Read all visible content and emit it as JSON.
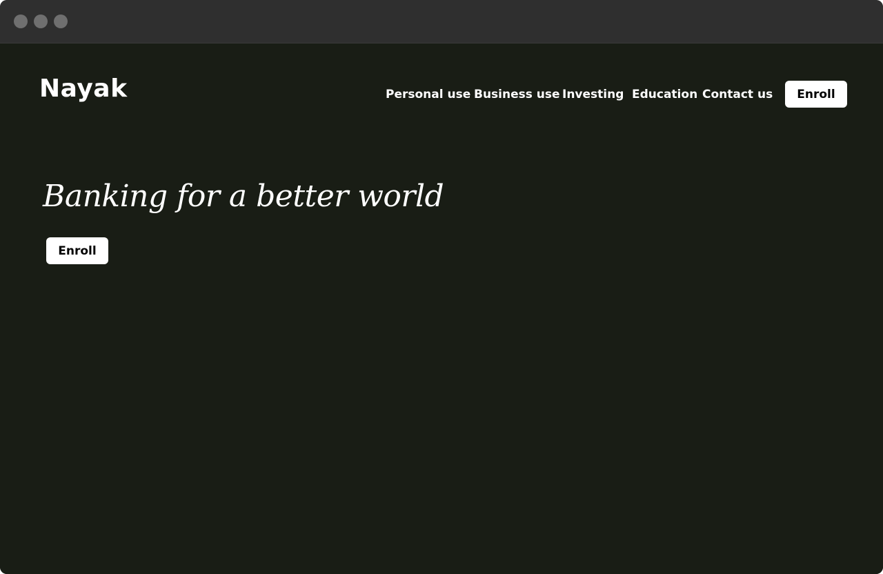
{
  "site": {
    "logo": "Nayak"
  },
  "nav": {
    "items": [
      {
        "label": "Personal use"
      },
      {
        "label": "Business use"
      },
      {
        "label": "Investing"
      },
      {
        "label": "Education"
      },
      {
        "label": "Contact us"
      }
    ],
    "cta_label": "Enroll"
  },
  "hero": {
    "title": "Banking for a better world",
    "cta_label": "Enroll"
  },
  "colors": {
    "background": "#191d15",
    "titlebar": "#2f2f2f",
    "button_bg": "#ffffff",
    "text": "#ffffff"
  }
}
